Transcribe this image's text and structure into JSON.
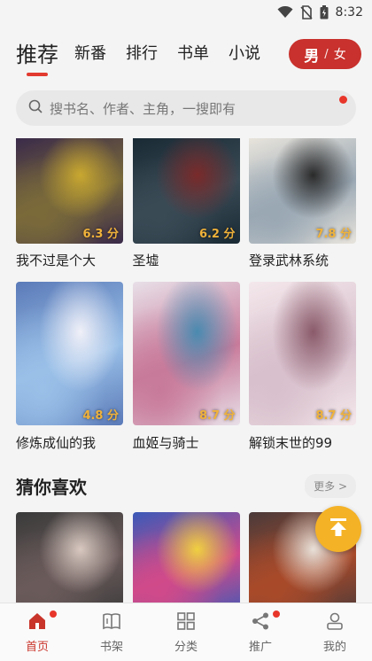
{
  "status": {
    "time": "8:32"
  },
  "topnav": {
    "tabs": [
      "推荐",
      "新番",
      "排行",
      "书单",
      "小说"
    ],
    "gender": {
      "male": "男",
      "sep": "/",
      "female": "女"
    }
  },
  "search": {
    "placeholder": "搜书名、作者、主角，一搜即有"
  },
  "grid_top": [
    {
      "title": "我不过是个大",
      "score": "6.3 分",
      "colors": [
        "#3a2a4a",
        "#7a6a3a",
        "#c9a830"
      ]
    },
    {
      "title": "圣墟",
      "score": "6.2 分",
      "colors": [
        "#1a2a35",
        "#3a4a55",
        "#7a2a2a"
      ]
    },
    {
      "title": "登录武林系统",
      "score": "7.8 分",
      "colors": [
        "#e8e4dc",
        "#9aa8b4",
        "#2a2a2a"
      ]
    }
  ],
  "grid_mid": [
    {
      "title": "修炼成仙的我",
      "score": "4.8 分",
      "colors": [
        "#5a7ab8",
        "#9ac0e8",
        "#f0f0f8"
      ]
    },
    {
      "title": "血姬与骑士",
      "score": "8.7 分",
      "colors": [
        "#e8e0e8",
        "#c87a9a",
        "#4a8ab0"
      ]
    },
    {
      "title": "解锁末世的99",
      "score": "8.7 分",
      "colors": [
        "#f4e8ec",
        "#d8c0cc",
        "#8a5a6a"
      ]
    }
  ],
  "section": {
    "title": "猜你喜欢",
    "more": "更多 >"
  },
  "grid_bottom": [
    {
      "colors": [
        "#3a3a3a",
        "#6a5a5a",
        "#d8c8c0"
      ]
    },
    {
      "colors": [
        "#3a5ab8",
        "#d04a8a",
        "#f0d040"
      ]
    },
    {
      "colors": [
        "#4a3a3a",
        "#a84a2a",
        "#e8e0d8"
      ]
    }
  ],
  "bottom_nav": [
    {
      "label": "首页",
      "icon": "home-icon",
      "active": true,
      "badge": true
    },
    {
      "label": "书架",
      "icon": "bookshelf-icon",
      "active": false,
      "badge": false
    },
    {
      "label": "分类",
      "icon": "category-icon",
      "active": false,
      "badge": false
    },
    {
      "label": "推广",
      "icon": "share-icon",
      "active": false,
      "badge": true
    },
    {
      "label": "我的",
      "icon": "profile-icon",
      "active": false,
      "badge": false
    }
  ],
  "accent": "#c8312d"
}
